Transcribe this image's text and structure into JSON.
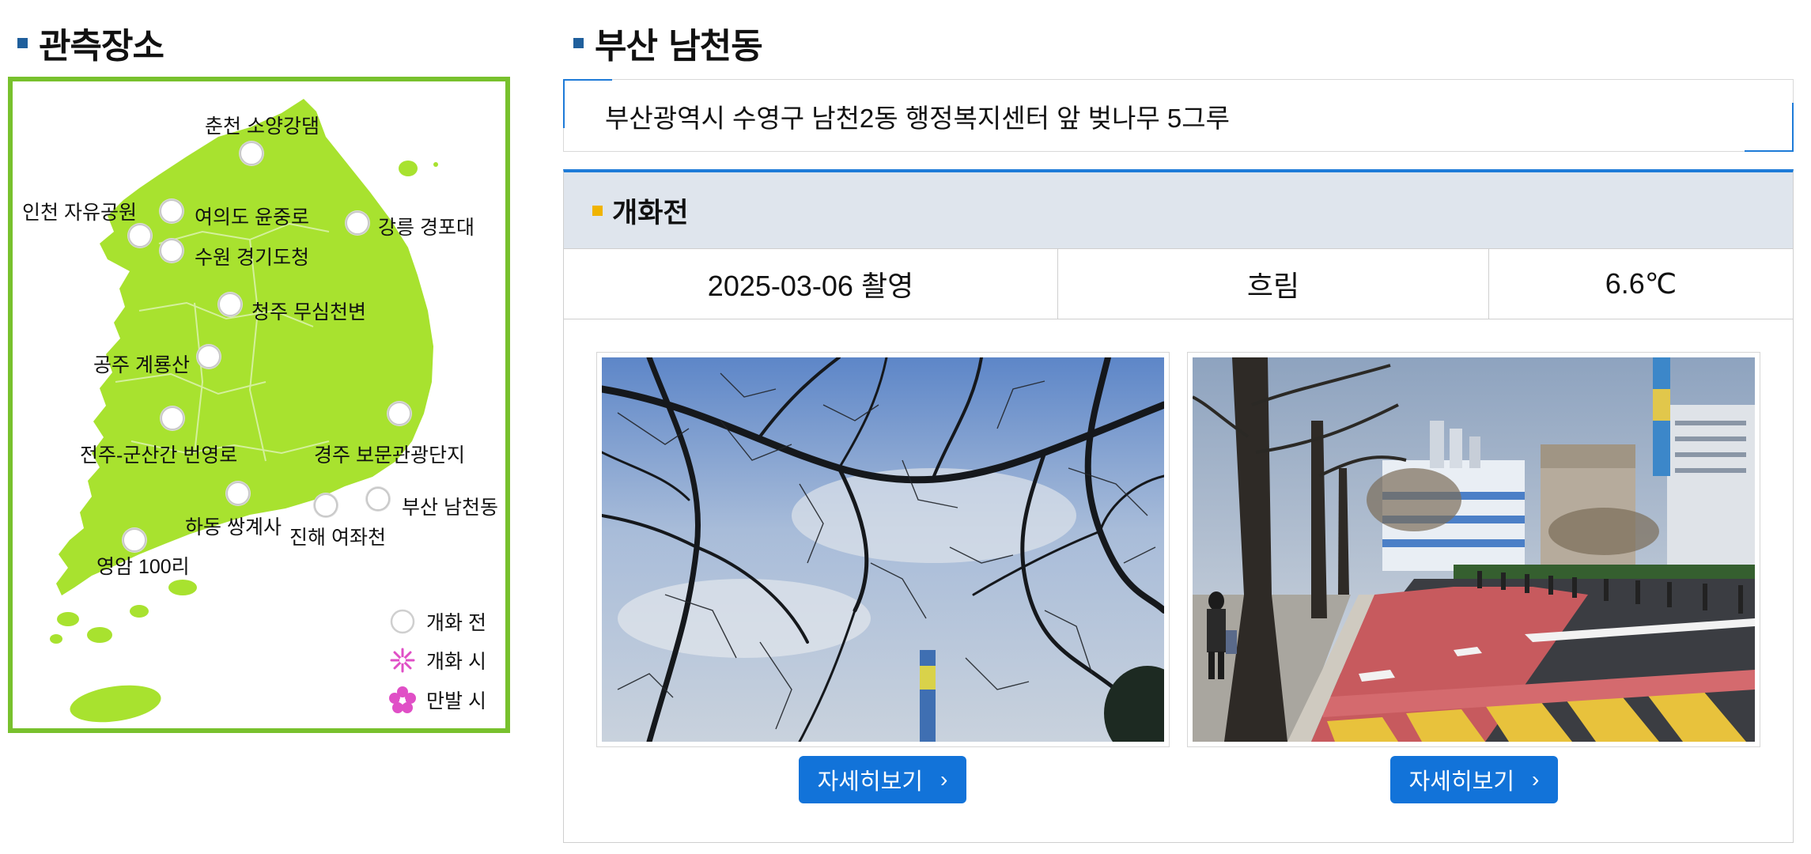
{
  "left": {
    "title": "관측장소",
    "locations": [
      {
        "id": "chuncheon",
        "label": "춘천 소양강댐"
      },
      {
        "id": "incheon",
        "label": "인천 자유공원"
      },
      {
        "id": "yeouido",
        "label": "여의도 윤중로"
      },
      {
        "id": "gangneung",
        "label": "강릉 경포대"
      },
      {
        "id": "suwon",
        "label": "수원 경기도청"
      },
      {
        "id": "cheongju",
        "label": "청주 무심천변"
      },
      {
        "id": "gongju",
        "label": "공주 계룡산"
      },
      {
        "id": "jeonju",
        "label": "전주-군산간 번영로"
      },
      {
        "id": "gyeongju",
        "label": "경주 보문관광단지"
      },
      {
        "id": "busan",
        "label": "부산 남천동"
      },
      {
        "id": "hadong",
        "label": "하동 쌍계사"
      },
      {
        "id": "jinhae",
        "label": "진해 여좌천"
      },
      {
        "id": "yeongam",
        "label": "영암 100리"
      }
    ],
    "legend": {
      "before": "개화 전",
      "blooming": "개화 시",
      "full": "만발 시"
    }
  },
  "right": {
    "title": "부산 남천동",
    "address": "부산광역시 수영구 남천2동 행정복지센터 앞 벚나무 5그루",
    "status_title": "개화전",
    "info": {
      "date": "2025-03-06 촬영",
      "weather": "흐림",
      "temperature": "6.6℃"
    },
    "detail_button_label": "자세히보기",
    "detail_chevron": "›"
  },
  "colors": {
    "map_land": "#a8e22f",
    "map_border": "#78c12d",
    "accent_blue": "#1273d9",
    "title_bullet": "#1f5f9c",
    "status_bullet": "#f0b400"
  }
}
